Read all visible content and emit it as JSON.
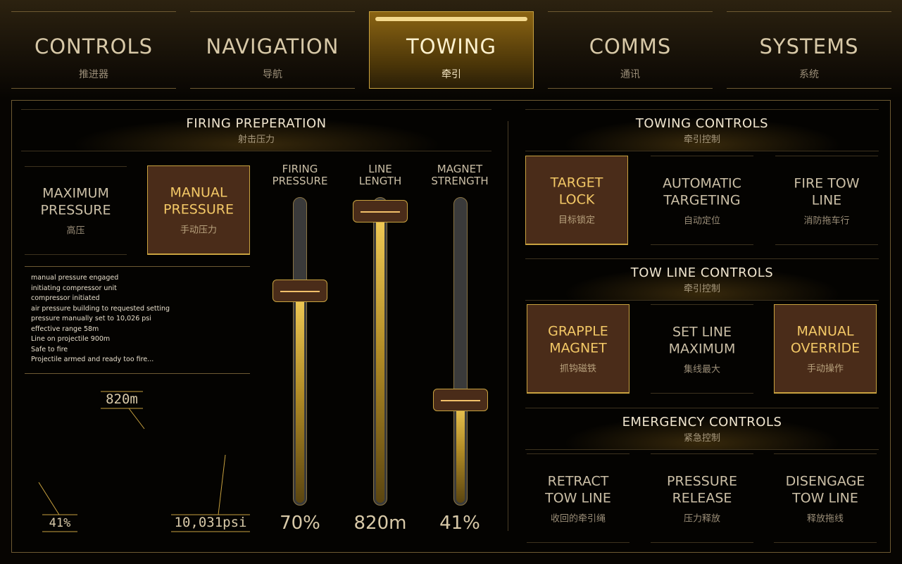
{
  "tabs": [
    {
      "label": "CONTROLS",
      "sub": "推进器"
    },
    {
      "label": "NAVIGATION",
      "sub": "导航"
    },
    {
      "label": "TOWING",
      "sub": "牵引"
    },
    {
      "label": "COMMS",
      "sub": "通讯"
    },
    {
      "label": "SYSTEMS",
      "sub": "系统"
    }
  ],
  "firing": {
    "title": "FIRING PREPERATION",
    "subtitle": "射击压力",
    "max_pressure": {
      "line1": "MAXIMUM",
      "line2": "PRESSURE",
      "sub": "高压"
    },
    "manual_pressure": {
      "line1": "MANUAL",
      "line2": "PRESSURE",
      "sub": "手动压力"
    },
    "log": [
      "manual pressure engaged",
      "initiating compressor unit",
      "compressor initiated",
      "air pressure building to requested setting",
      "pressure manually set to 10,026 psi",
      "effective range 58m",
      "Line on projectile 900m",
      "Safe to fire",
      "Projectile armed and ready too fire..."
    ],
    "callouts": {
      "range": "820m",
      "pct": "41%",
      "psi": "10,031psi"
    },
    "sliders": [
      {
        "label1": "FIRING",
        "label2": "PRESSURE",
        "value": "70%",
        "level": 0.7
      },
      {
        "label1": "LINE",
        "label2": "LENGTH",
        "value": "820m",
        "level": 0.96
      },
      {
        "label1": "MAGNET",
        "label2": "STRENGTH",
        "value": "41%",
        "level": 0.34
      }
    ]
  },
  "towing_controls": {
    "title": "TOWING CONTROLS",
    "subtitle": "牵引控制",
    "buttons": [
      {
        "line1": "TARGET",
        "line2": "LOCK",
        "sub": "目标锁定",
        "active": true
      },
      {
        "line1": "AUTOMATIC",
        "line2": "TARGETING",
        "sub": "自动定位",
        "active": false
      },
      {
        "line1": "FIRE TOW",
        "line2": "LINE",
        "sub": "消防拖车行",
        "active": false
      }
    ]
  },
  "tow_line_controls": {
    "title": "TOW LINE CONTROLS",
    "subtitle": "牵引控制",
    "buttons": [
      {
        "line1": "GRAPPLE",
        "line2": "MAGNET",
        "sub": "抓钩磁铁",
        "active": true
      },
      {
        "line1": "SET LINE",
        "line2": "MAXIMUM",
        "sub": "集线最大",
        "active": false
      },
      {
        "line1": "MANUAL",
        "line2": "OVERRIDE",
        "sub": "手动操作",
        "active": true
      }
    ]
  },
  "emergency_controls": {
    "title": "EMERGENCY CONTROLS",
    "subtitle": "紧急控制",
    "buttons": [
      {
        "line1": "RETRACT",
        "line2": "TOW LINE",
        "sub": "收回的牵引绳",
        "active": false
      },
      {
        "line1": "PRESSURE",
        "line2": "RELEASE",
        "sub": "压力释放",
        "active": false
      },
      {
        "line1": "DISENGAGE",
        "line2": "TOW LINE",
        "sub": "释放拖线",
        "active": false
      }
    ]
  },
  "colors": {
    "accent": "#c9a23f",
    "active_bg": "#4a2c19",
    "active_text": "#f3c866"
  }
}
